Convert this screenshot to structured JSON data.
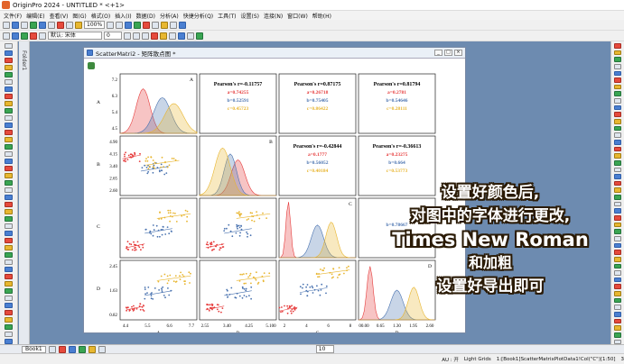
{
  "app": {
    "title": "OriginPro 2024 - UNTITLED * <+1>"
  },
  "menu": [
    "文件(F)",
    "编辑(E)",
    "查看(V)",
    "图(G)",
    "格式(O)",
    "插入(I)",
    "数据(D)",
    "分析(A)",
    "快捷分析(Q)",
    "工具(T)",
    "设置(S)",
    "连接(N)",
    "窗口(W)",
    "帮助(H)"
  ],
  "toolbar": {
    "zoom": "100%",
    "font": "默认: 宋体",
    "font_size": "0"
  },
  "project": {
    "label": "Folder1"
  },
  "window": {
    "title": "ScatterMatri2 - 矩阵散点图 *"
  },
  "chart_data": {
    "type": "scatter-matrix",
    "variables": [
      "A",
      "B",
      "C",
      "D"
    ],
    "groups": [
      {
        "name": "a",
        "color": "#e63c3c"
      },
      {
        "name": "b",
        "color": "#4a73b0"
      },
      {
        "name": "c",
        "color": "#e8b52f"
      }
    ],
    "ticks": {
      "A": [
        "4.4",
        "5.5",
        "6.6",
        "7.7"
      ],
      "A_y": [
        "7.2",
        "6.3",
        "5.4",
        "4.5"
      ],
      "B": [
        "2.55",
        "3.40",
        "4.25",
        "5.100"
      ],
      "B_y": [
        "4.90",
        "4.15",
        "3.40",
        "2.65",
        "2.60"
      ],
      "C": [
        "2",
        "4",
        "6",
        "8"
      ],
      "D": [
        "00.00",
        "0.65",
        "1.30",
        "1.95",
        "2.60"
      ],
      "D_y": [
        "2.45",
        "1.63",
        "0.82"
      ]
    },
    "corr": [
      {
        "title": "Pearson's r=-0.11757",
        "a": "a=0.74255",
        "b": "b=0.52591",
        "c": "c=0.45723"
      },
      {
        "title": "Pearson's r=0.87175",
        "a": "a=0.26718",
        "b": "b=0.75405",
        "c": "c=0.86422"
      },
      {
        "title": "Pearson's r=0.81794",
        "a": "a=0.2781",
        "b": "b=0.54646",
        "c": "c=0.28111"
      },
      {
        "title": "Pearson's r=-0.42844",
        "a": "a=0.1777",
        "b": "b=0.56052",
        "c": "c=0.40184"
      },
      {
        "title": "Pearson's r=-0.36613",
        "a": "a=0.23275",
        "b": "b=0.664",
        "c": "c=0.53773"
      },
      {
        "title": "",
        "a": "",
        "b": "b=0.78667",
        "c": ""
      }
    ],
    "panel_letters": [
      "A",
      "B",
      "C",
      "D"
    ]
  },
  "overlay": {
    "l1": "设置好颜色后,",
    "l2": "对图中的字体进行更改,",
    "l3": "Times New Roman",
    "l4": "和加粗",
    "l5": "设置好导出即可"
  },
  "bottom": {
    "sheet": "Book1",
    "page": "10"
  },
  "status": {
    "a": "AU : 开",
    "b": "Light Grids",
    "c": "1:[Book1]ScatterMatrixPlotData1!Col(\"C\")[1:50]",
    "d": "3"
  }
}
